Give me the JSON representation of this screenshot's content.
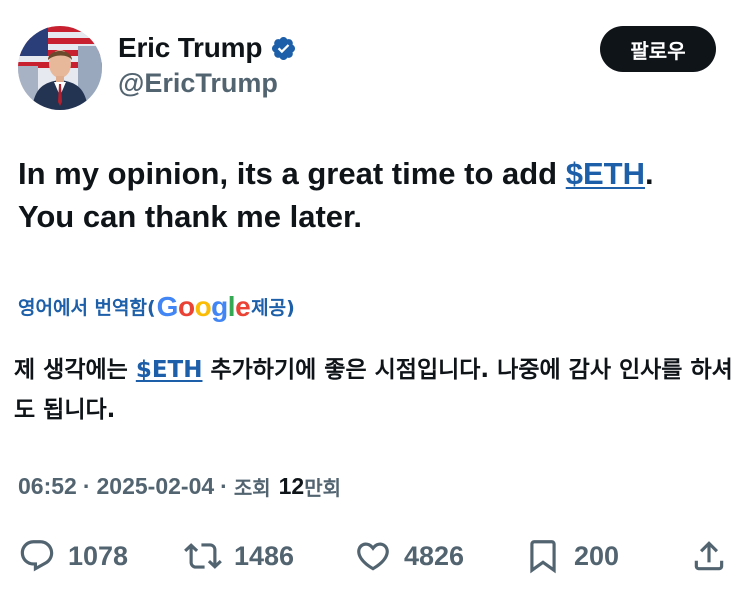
{
  "author": {
    "display_name": "Eric Trump",
    "handle": "@EricTrump",
    "verified_icon": "verified-badge-icon",
    "avatar_icon": "profile-photo"
  },
  "follow_button": {
    "label": "팔로우"
  },
  "tweet": {
    "text_line1_before": "In my opinion, its a great time to add ",
    "cashtag": "$ETH",
    "text_line1_after": ".",
    "text_line2": "You can thank me later."
  },
  "translation": {
    "prefix": "영어에서 번역함(",
    "provider": "Google",
    "suffix": " 제공)",
    "text_before": "제 생각에는 ",
    "cashtag": "$ETH",
    "text_after": " 추가하기에 좋은 시점입니다. 나중에 감사 인사를 하셔도 됩니다."
  },
  "meta": {
    "time": "06:52",
    "separator": "·",
    "date": "2025-02-04",
    "views_label": "조회",
    "views_count": "12",
    "views_unit": "만회"
  },
  "actions": {
    "replies": "1078",
    "retweets": "1486",
    "likes": "4826",
    "bookmarks": "200"
  },
  "colors": {
    "text": "#0f1419",
    "secondary": "#536471",
    "link": "#1d5fa8",
    "verified": "#1d5fa8",
    "button_bg": "#0f1419"
  }
}
